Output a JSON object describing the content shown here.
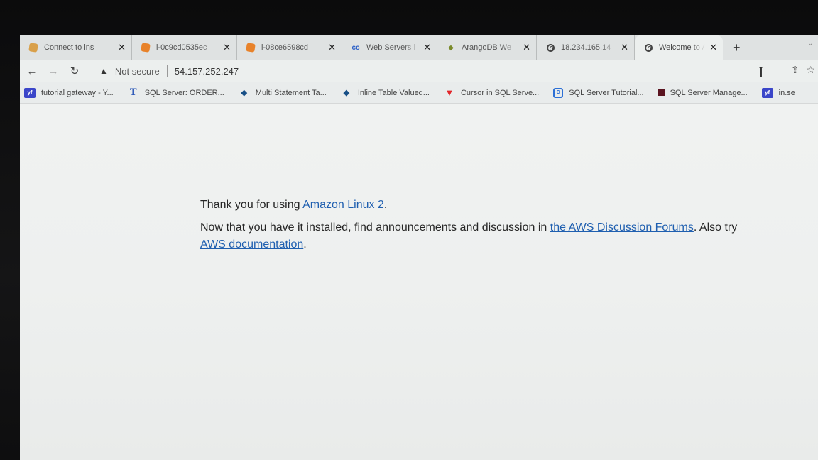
{
  "tabs": [
    {
      "title": "Connect to ins",
      "icon": "aws-orange-icon"
    },
    {
      "title": "i-0c9cd0535ec",
      "icon": "aws-orange-icon"
    },
    {
      "title": "i-08ce6598cd",
      "icon": "aws-orange-icon"
    },
    {
      "title": "Web Servers i",
      "icon": "cc-icon",
      "icon_text": "cc"
    },
    {
      "title": "ArangoDB We",
      "icon": "arangodb-icon"
    },
    {
      "title": "18.234.165.14",
      "icon": "globe-icon"
    },
    {
      "title": "Welcome to A",
      "icon": "globe-icon",
      "active": true
    }
  ],
  "newtab_label": "+",
  "tab_menu_label": "⌄",
  "address": {
    "security_icon": "▲",
    "security_label": "Not secure",
    "url": "54.157.252.247"
  },
  "bookmarks": [
    {
      "label": "tutorial gateway - Y...",
      "icon": "yf-icon",
      "icon_text": "yf"
    },
    {
      "label": "SQL Server: ORDER...",
      "icon": "t-icon",
      "icon_text": "T"
    },
    {
      "label": "Multi Statement Ta...",
      "icon": "diamond-icon",
      "icon_text": "◆"
    },
    {
      "label": "Inline Table Valued...",
      "icon": "diamond-icon",
      "icon_text": "◆"
    },
    {
      "label": "Cursor in SQL Serve...",
      "icon": "v-red-icon",
      "icon_text": "▼"
    },
    {
      "label": "SQL Server Tutorial...",
      "icon": "d-blue-icon",
      "icon_text": "D"
    },
    {
      "label": "SQL Server Manage...",
      "icon": "square-icon",
      "icon_text": ""
    },
    {
      "label": "in.se",
      "icon": "yf-icon",
      "icon_text": "yf"
    }
  ],
  "page": {
    "line1_prefix": "Thank you for using ",
    "line1_link": "Amazon Linux 2",
    "line1_suffix": ".",
    "line2_prefix": "Now that you have it installed, find announcements and discussion in ",
    "line2_link": "the AWS Discussion Forums",
    "line2_middle": ". Also try",
    "line2_link2": "AWS documentation",
    "line2_suffix": "."
  },
  "colors": {
    "link": "#1f5fb0",
    "aws_orange": "#e8822a"
  }
}
